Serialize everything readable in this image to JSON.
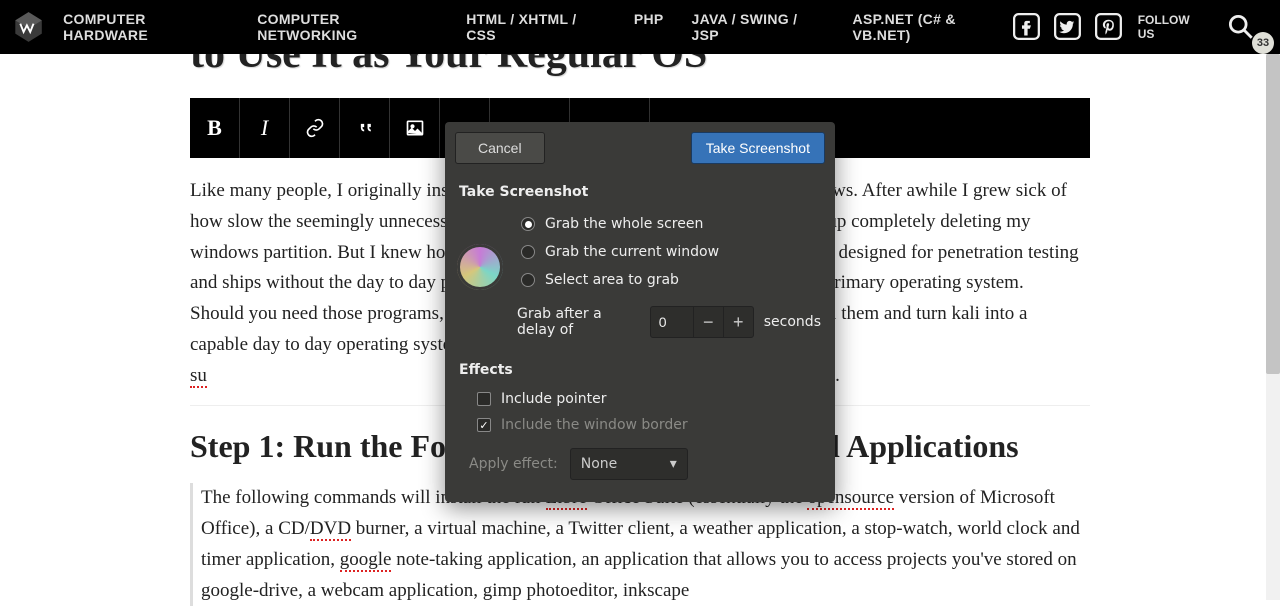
{
  "nav": {
    "items": [
      "COMPUTER HARDWARE",
      "COMPUTER NETWORKING",
      "HTML / XHTML / CSS",
      "PHP",
      "JAVA / SWING / JSP",
      "ASP.NET (C# & VB.NET)"
    ],
    "follow": "FOLLOW US",
    "badge": "33"
  },
  "page": {
    "title": "to Use It as Your Regular OS",
    "body": "Like many people, I originally installed Kali Linux on my PC dual booted on Windows. After awhile I grew sick of how slow the seemingly unnecessary Windows was to switch and eventually ended up completely deleting my windows partition. But I knew how silly this was, since Kali is of course specifically designed for penetration testing and ships without the day to day programs and applications one needs to use it as a primary operating system. Should you need those programs, the following instructions will enable you to install them and turn kali into a capable day to day operating system. Note I still run everything in ",
    "body_link": "su",
    "body_rest": "y? Let's begin.",
    "step_title": "Step 1: Run the Following Commands to Install Applications",
    "commands_block": {
      "t0": "The following commands will install the full ",
      "sp0": "Libre",
      "t1": " Office Suite (essentially the ",
      "sp1": "opensource",
      "t2": " version of Microsoft Office), a CD/",
      "sp2": "DVD",
      "t3": " burner, a virtual machine, a Twitter client, a weather application, a stop-watch, world clock and timer application, ",
      "sp3": "google",
      "t4": " note-taking application, an application that allows you to access projects you've stored on google-drive, a webcam application, gimp photoeditor, inkscape"
    }
  },
  "dialog": {
    "cancel": "Cancel",
    "take": "Take Screenshot",
    "section": "Take Screenshot",
    "options": {
      "whole": "Grab the whole screen",
      "window": "Grab the current window",
      "area": "Select area to grab"
    },
    "selected_option": "whole",
    "delay_label_pre": "Grab after a delay of",
    "delay_value": "0",
    "delay_label_post": "seconds",
    "effects_title": "Effects",
    "include_pointer": "Include pointer",
    "include_border": "Include the window border",
    "include_pointer_checked": false,
    "include_border_checked": true,
    "apply_label": "Apply effect:",
    "apply_value": "None"
  }
}
